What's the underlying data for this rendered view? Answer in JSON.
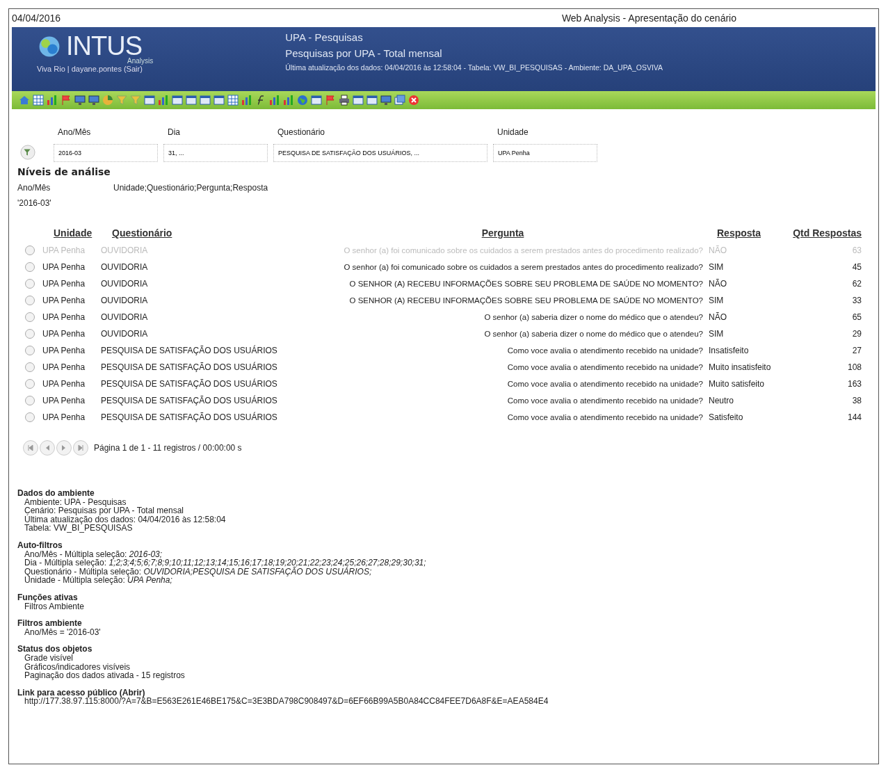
{
  "page_header": {
    "date": "04/04/2016",
    "title": "Web Analysis - Apresentação do cenário"
  },
  "banner": {
    "logo": "INTUS",
    "logo_sub": "Analysis",
    "user_line": "Viva Rio | dayane.pontes (Sair)",
    "environment": "UPA - Pesquisas",
    "scenario": "Pesquisas por UPA - Total mensal",
    "update_line": "Última atualização dos dados: 04/04/2016 às 12:58:04 - Tabela: VW_BI_PESQUISAS - Ambiente: DA_UPA_OSVIVA"
  },
  "filters": [
    {
      "label": "Ano/Mês",
      "value": "2016-03"
    },
    {
      "label": "Dia",
      "value": "31, ..."
    },
    {
      "label": "Questionário",
      "value": "PESQUISA DE SATISFAÇÃO DOS USUÁRIOS, ..."
    },
    {
      "label": "Unidade",
      "value": "UPA Penha"
    }
  ],
  "levels": {
    "title": "Níveis de análise",
    "row_label": "Ano/Mês",
    "row_levels": "Unidade;Questionário;Pergunta;Resposta",
    "row_value": "'2016-03'"
  },
  "table": {
    "columns": [
      "Unidade",
      "Questionário",
      "Pergunta",
      "Resposta",
      "Qtd Respostas"
    ],
    "rows": [
      {
        "selected": false,
        "dimmed": true,
        "cells": [
          "UPA Penha",
          "OUVIDORIA",
          "O senhor (a) foi comunicado sobre os cuidados a serem prestados antes do procedimento realizado?",
          "NÃO",
          "63"
        ]
      },
      {
        "selected": false,
        "dimmed": false,
        "cells": [
          "UPA Penha",
          "OUVIDORIA",
          "O senhor (a) foi comunicado sobre os cuidados a serem prestados antes do procedimento realizado?",
          "SIM",
          "45"
        ]
      },
      {
        "selected": false,
        "dimmed": false,
        "cells": [
          "UPA Penha",
          "OUVIDORIA",
          "O SENHOR (A) RECEBU INFORMAÇÕES SOBRE SEU PROBLEMA DE SAÚDE NO MOMENTO?",
          "NÃO",
          "62"
        ]
      },
      {
        "selected": false,
        "dimmed": false,
        "cells": [
          "UPA Penha",
          "OUVIDORIA",
          "O SENHOR (A) RECEBU INFORMAÇÕES SOBRE SEU PROBLEMA DE SAÚDE NO MOMENTO?",
          "SIM",
          "33"
        ]
      },
      {
        "selected": false,
        "dimmed": false,
        "cells": [
          "UPA Penha",
          "OUVIDORIA",
          "O senhor (a) saberia dizer o nome do médico que o atendeu?",
          "NÃO",
          "65"
        ]
      },
      {
        "selected": false,
        "dimmed": false,
        "cells": [
          "UPA Penha",
          "OUVIDORIA",
          "O senhor (a) saberia dizer o nome do médico que o atendeu?",
          "SIM",
          "29"
        ]
      },
      {
        "selected": false,
        "dimmed": false,
        "cells": [
          "UPA Penha",
          "PESQUISA DE SATISFAÇÃO DOS USUÁRIOS",
          "Como voce avalia o atendimento recebido na unidade?",
          "Insatisfeito",
          "27"
        ]
      },
      {
        "selected": false,
        "dimmed": false,
        "cells": [
          "UPA Penha",
          "PESQUISA DE SATISFAÇÃO DOS USUÁRIOS",
          "Como voce avalia o atendimento recebido na unidade?",
          "Muito insatisfeito",
          "108"
        ]
      },
      {
        "selected": false,
        "dimmed": false,
        "cells": [
          "UPA Penha",
          "PESQUISA DE SATISFAÇÃO DOS USUÁRIOS",
          "Como voce avalia o atendimento recebido na unidade?",
          "Muito satisfeito",
          "163"
        ]
      },
      {
        "selected": false,
        "dimmed": false,
        "cells": [
          "UPA Penha",
          "PESQUISA DE SATISFAÇÃO DOS USUÁRIOS",
          "Como voce avalia o atendimento recebido na unidade?",
          "Neutro",
          "38"
        ]
      },
      {
        "selected": false,
        "dimmed": false,
        "cells": [
          "UPA Penha",
          "PESQUISA DE SATISFAÇÃO DOS USUÁRIOS",
          "Como voce avalia o atendimento recebido na unidade?",
          "Satisfeito",
          "144"
        ]
      }
    ]
  },
  "pager": {
    "text": "Página 1 de 1 - 11 registros / 00:00:00 s"
  },
  "details": [
    {
      "title": "Dados do ambiente",
      "lines": [
        "Ambiente: UPA - Pesquisas",
        "Cenário: Pesquisas por UPA - Total mensal",
        "Última atualização dos dados: 04/04/2016 às 12:58:04",
        "Tabela: VW_BI_PESQUISAS"
      ]
    },
    {
      "title": "Auto-filtros",
      "lines": [
        "Ano/Mês - Múltipla seleção: *2016-03;*",
        "Dia - Múltipla seleção: *1;2;3;4;5;6;7;8;9;10;11;12;13;14;15;16;17;18;19;20;21;22;23;24;25;26;27;28;29;30;31;*",
        "Questionário - Múltipla seleção: *OUVIDORIA;PESQUISA DE SATISFAÇÃO DOS USUÁRIOS;*",
        "Unidade - Múltipla seleção: *UPA Penha;*"
      ]
    },
    {
      "title": "Funções ativas",
      "lines": [
        "Filtros Ambiente"
      ]
    },
    {
      "title": "Filtros ambiente",
      "lines": [
        "Ano/Mês = '2016-03'"
      ]
    },
    {
      "title": "Status dos objetos",
      "lines": [
        "Grade visível",
        "Gráficos/indicadores visíveis",
        "Paginação dos dados ativada - 15 registros"
      ]
    },
    {
      "title": "Link para acesso público (Abrir)",
      "lines": [
        "http://177.38.97.115:8000/?A=7&B=E563E261E46BE175&C=3E3BDA798C908497&D=6EF66B99A5B0A84CC84FEE7D6A8F&E=AEA584E4"
      ]
    }
  ]
}
